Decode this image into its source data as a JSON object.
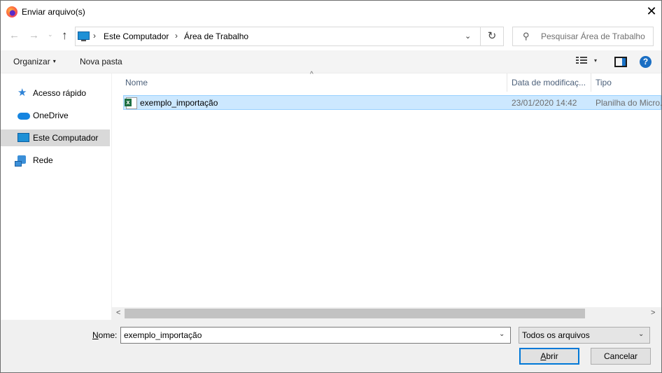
{
  "window": {
    "title": "Enviar arquivo(s)",
    "close_glyph": "✕"
  },
  "nav": {
    "back_glyph": "←",
    "forward_glyph": "→",
    "recent_glyph": "⌄",
    "up_glyph": "↑",
    "breadcrumb": [
      "Este Computador",
      "Área de Trabalho"
    ],
    "separator": "›",
    "dropdown_glyph": "⌄",
    "refresh_glyph": "↻"
  },
  "search": {
    "placeholder": "Pesquisar Área de Trabalho",
    "icon": "search-icon"
  },
  "toolbar": {
    "organize_label": "Organizar",
    "organize_caret": "▾",
    "new_folder_label": "Nova pasta",
    "view_dropdown_glyph": "▾",
    "help_glyph": "?"
  },
  "sidebar": {
    "items": [
      {
        "label": "Acesso rápido",
        "icon": "star-icon",
        "selected": false
      },
      {
        "label": "OneDrive",
        "icon": "cloud-icon",
        "selected": false
      },
      {
        "label": "Este Computador",
        "icon": "computer-icon",
        "selected": true
      },
      {
        "label": "Rede",
        "icon": "network-icon",
        "selected": false
      }
    ]
  },
  "columns": {
    "sort_glyph": "^",
    "name": "Nome",
    "date": "Data de modificaç...",
    "type": "Tipo"
  },
  "files": [
    {
      "name": "exemplo_importação",
      "date": "23/01/2020 14:42",
      "type": "Planilha do Micro...",
      "icon": "excel-file-icon",
      "selected": true
    }
  ],
  "scroll": {
    "left_glyph": "<",
    "right_glyph": ">"
  },
  "footer": {
    "name_label_prefix": "N",
    "name_label_rest": "ome:",
    "name_value": "exemplo_importação",
    "name_dropdown_glyph": "⌄",
    "filter_value": "Todos os arquivos",
    "filter_dropdown_glyph": "⌄",
    "open_label_prefix": "A",
    "open_label_rest": "brir",
    "cancel_label": "Cancelar"
  },
  "colors": {
    "accent": "#0078d7",
    "selection_bg": "#cce8ff",
    "selection_border": "#99d1ff",
    "sidebar_selected": "#d9d9d9"
  }
}
